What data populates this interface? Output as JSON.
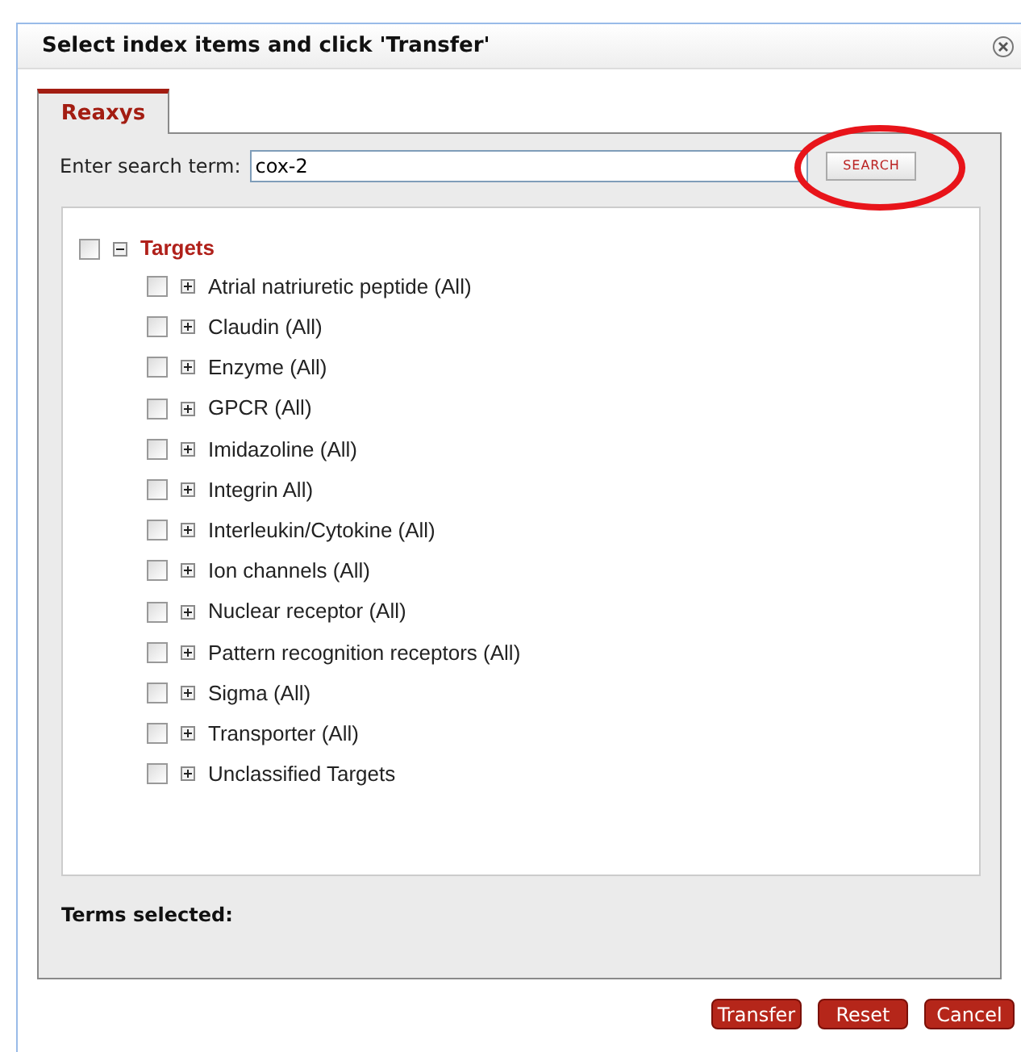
{
  "dialog": {
    "title": "Select index items and click 'Transfer'"
  },
  "tabs": [
    {
      "label": "Reaxys",
      "selected": true
    }
  ],
  "search": {
    "label": "Enter search term:",
    "value": "cox-2",
    "button": "SEARCH"
  },
  "tree": [
    {
      "label": "Targets",
      "checked": false,
      "expanded": true,
      "children": [
        {
          "label": "Atrial natriuretic peptide (All)",
          "checked": false,
          "expanded": false
        },
        {
          "label": "Claudin (All)",
          "checked": false,
          "expanded": false
        },
        {
          "label": "Enzyme (All)",
          "checked": false,
          "expanded": false
        },
        {
          "label": "GPCR (All)",
          "checked": false,
          "expanded": false
        },
        {
          "label": "Imidazoline (All)",
          "checked": false,
          "expanded": false
        },
        {
          "label": "Integrin All)",
          "checked": false,
          "expanded": false
        },
        {
          "label": "Interleukin/Cytokine (All)",
          "checked": false,
          "expanded": false
        },
        {
          "label": "Ion channels (All)",
          "checked": false,
          "expanded": false
        },
        {
          "label": "Nuclear receptor (All)",
          "checked": false,
          "expanded": false
        },
        {
          "label": "Pattern recognition receptors (All)",
          "checked": false,
          "expanded": false
        },
        {
          "label": "Sigma (All)",
          "checked": false,
          "expanded": false
        },
        {
          "label": "Transporter (All)",
          "checked": false,
          "expanded": false
        },
        {
          "label": "Unclassified Targets",
          "checked": false,
          "expanded": false
        }
      ]
    }
  ],
  "terms_selected": "Terms selected:",
  "buttons": [
    "Transfer",
    "Reset",
    "Cancel"
  ]
}
